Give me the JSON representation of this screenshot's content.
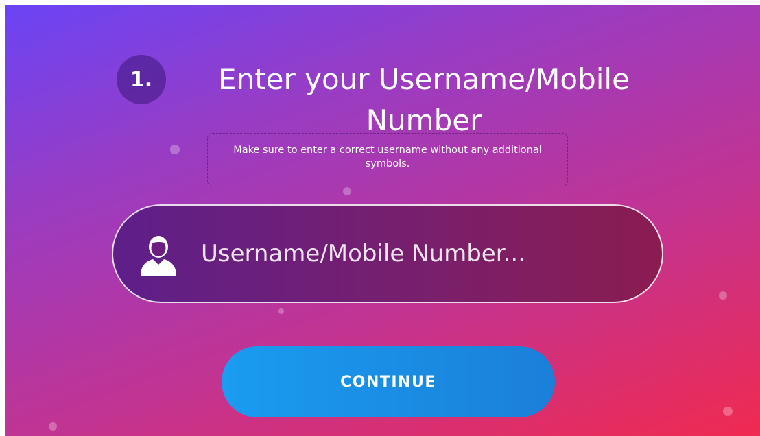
{
  "step": {
    "number": "1."
  },
  "title": "Enter your Username/Mobile Number",
  "hint": "Make sure to enter a correct username without any additional symbols.",
  "input": {
    "placeholder": "Username/Mobile Number...",
    "value": "",
    "icon": "user-icon"
  },
  "continue_label": "CONTINUE",
  "colors": {
    "gradient_start": "#6b44f5",
    "gradient_end": "#f02a50",
    "button": "#1b8ce4",
    "input_bg": "#6e1f78"
  }
}
